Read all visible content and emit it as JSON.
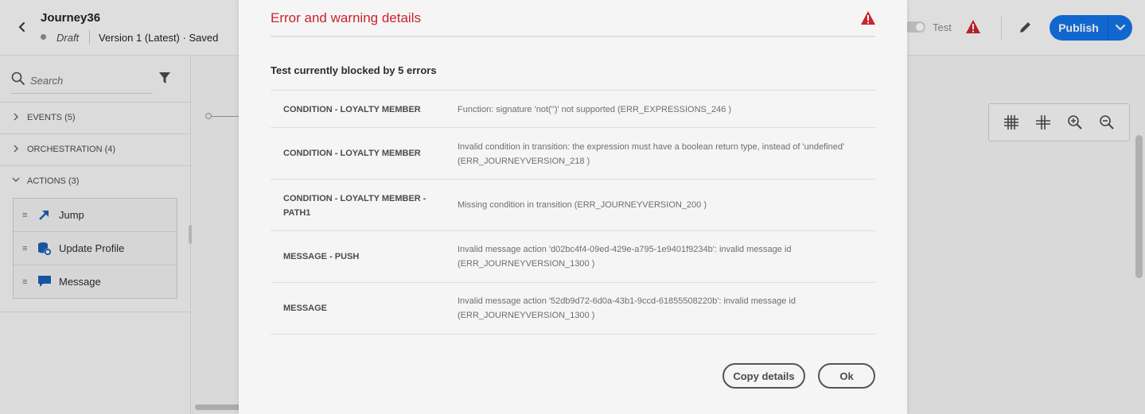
{
  "header": {
    "title": "Journey36",
    "status": "Draft",
    "version": "Version 1 (Latest) · Saved",
    "test_label": "Test",
    "publish_label": "Publish"
  },
  "sidebar": {
    "search_placeholder": "Search",
    "sections": [
      {
        "label": "EVENTS (5)",
        "expanded": false
      },
      {
        "label": "ORCHESTRATION (4)",
        "expanded": false
      },
      {
        "label": "ACTIONS (3)",
        "expanded": true
      }
    ],
    "actions": [
      {
        "label": "Jump",
        "icon": "jump-arrow-icon"
      },
      {
        "label": "Update Profile",
        "icon": "database-settings-icon"
      },
      {
        "label": "Message",
        "icon": "chat-bubble-icon"
      }
    ]
  },
  "canvas": {
    "tools": [
      "grid-icon",
      "snap-grid-icon",
      "zoom-in-icon",
      "zoom-out-icon"
    ]
  },
  "modal": {
    "title": "Error and warning details",
    "subtitle": "Test currently blocked by 5 errors",
    "errors": [
      {
        "name": "CONDITION - LOYALTY MEMBER",
        "message": "Function: signature 'not('')' not supported (ERR_EXPRESSIONS_246 )"
      },
      {
        "name": "CONDITION - LOYALTY MEMBER",
        "message": "Invalid condition in transition: the expression must have a boolean return type, instead of 'undefined' (ERR_JOURNEYVERSION_218 )"
      },
      {
        "name": "CONDITION - LOYALTY MEMBER - PATH1",
        "message": "Missing condition in transition (ERR_JOURNEYVERSION_200 )"
      },
      {
        "name": "MESSAGE - PUSH",
        "message": "Invalid message action 'd02bc4f4-09ed-429e-a795-1e9401f9234b': invalid message id (ERR_JOURNEYVERSION_1300 )"
      },
      {
        "name": "MESSAGE",
        "message": "Invalid message action '52db9d72-6d0a-43b1-9ccd-61855508220b': invalid message id (ERR_JOURNEYVERSION_1300 )"
      }
    ],
    "copy_button": "Copy details",
    "ok_button": "Ok"
  },
  "colors": {
    "accent": "#1473e6",
    "error": "#c9252d",
    "action_icon": "#1a5fb4"
  }
}
